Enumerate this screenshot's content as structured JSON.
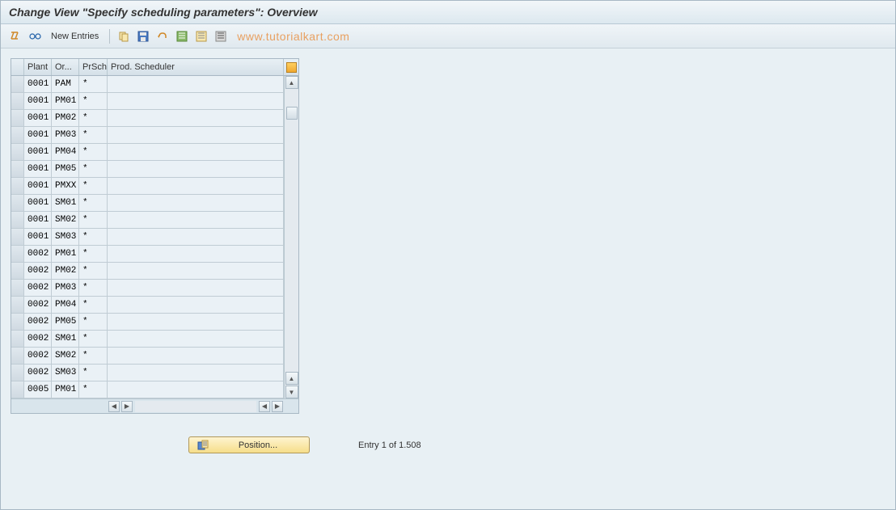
{
  "title": "Change View \"Specify scheduling parameters\": Overview",
  "toolbar": {
    "new_entries": "New Entries"
  },
  "watermark": "www.tutorialkart.com",
  "table": {
    "headers": {
      "plant": "Plant",
      "or": "Or...",
      "prsch": "PrSch",
      "prod": "Prod. Scheduler"
    },
    "rows": [
      {
        "plant": "0001",
        "or": "PAM",
        "prsch": "*",
        "prod": ""
      },
      {
        "plant": "0001",
        "or": "PM01",
        "prsch": "*",
        "prod": ""
      },
      {
        "plant": "0001",
        "or": "PM02",
        "prsch": "*",
        "prod": ""
      },
      {
        "plant": "0001",
        "or": "PM03",
        "prsch": "*",
        "prod": ""
      },
      {
        "plant": "0001",
        "or": "PM04",
        "prsch": "*",
        "prod": ""
      },
      {
        "plant": "0001",
        "or": "PM05",
        "prsch": "*",
        "prod": ""
      },
      {
        "plant": "0001",
        "or": "PMXX",
        "prsch": "*",
        "prod": ""
      },
      {
        "plant": "0001",
        "or": "SM01",
        "prsch": "*",
        "prod": ""
      },
      {
        "plant": "0001",
        "or": "SM02",
        "prsch": "*",
        "prod": ""
      },
      {
        "plant": "0001",
        "or": "SM03",
        "prsch": "*",
        "prod": ""
      },
      {
        "plant": "0002",
        "or": "PM01",
        "prsch": "*",
        "prod": ""
      },
      {
        "plant": "0002",
        "or": "PM02",
        "prsch": "*",
        "prod": ""
      },
      {
        "plant": "0002",
        "or": "PM03",
        "prsch": "*",
        "prod": ""
      },
      {
        "plant": "0002",
        "or": "PM04",
        "prsch": "*",
        "prod": ""
      },
      {
        "plant": "0002",
        "or": "PM05",
        "prsch": "*",
        "prod": ""
      },
      {
        "plant": "0002",
        "or": "SM01",
        "prsch": "*",
        "prod": ""
      },
      {
        "plant": "0002",
        "or": "SM02",
        "prsch": "*",
        "prod": ""
      },
      {
        "plant": "0002",
        "or": "SM03",
        "prsch": "*",
        "prod": ""
      },
      {
        "plant": "0005",
        "or": "PM01",
        "prsch": "*",
        "prod": ""
      }
    ]
  },
  "position_button": "Position...",
  "entry_info": "Entry 1 of 1.508"
}
